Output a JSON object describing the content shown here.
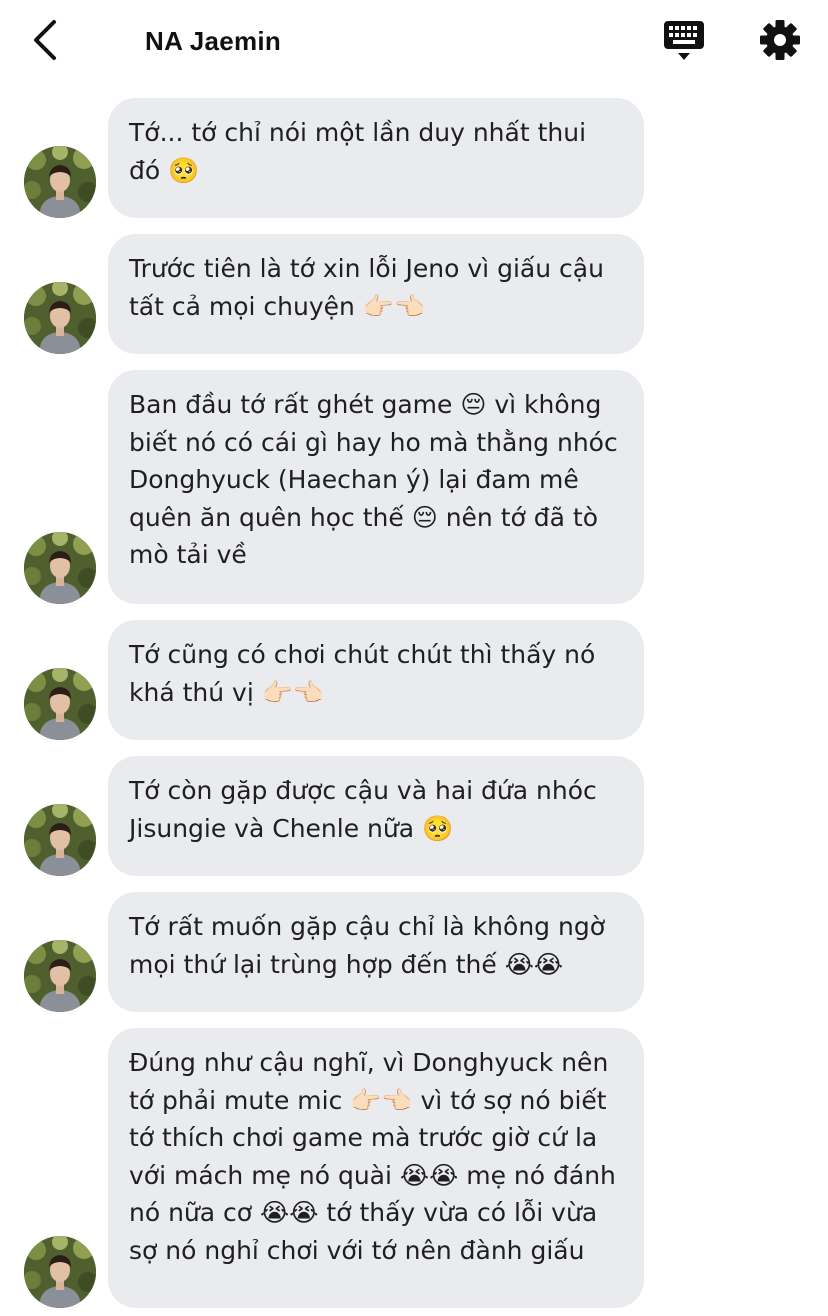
{
  "header": {
    "title": "NA Jaemin",
    "back_icon": "chevron-left-icon",
    "keyboard_icon": "keyboard-icon",
    "settings_icon": "gear-icon"
  },
  "colors": {
    "bubble": "#e9ebef",
    "text": "#1f1f22",
    "background": "#ffffff"
  },
  "messages": [
    {
      "text": "Tớ... tớ chỉ nói một lần duy nhất thui đó 🥺"
    },
    {
      "text": "Trước tiên là tớ xin lỗi Jeno vì giấu cậu tất cả mọi chuyện 👉🏻👈🏻"
    },
    {
      "text": "Ban đầu tớ rất ghét game 😔 vì không biết nó có cái gì hay ho mà thằng nhóc Donghyuck (Haechan ý) lại đam mê quên ăn quên học thế 😔 nên tớ đã tò mò tải về"
    },
    {
      "text": "Tớ cũng có chơi chút chút thì thấy nó khá thú vị 👉🏻👈🏻"
    },
    {
      "text": "Tớ còn gặp được cậu và hai đứa nhóc Jisungie và Chenle nữa 🥺"
    },
    {
      "text": "Tớ rất muốn gặp cậu chỉ là không ngờ mọi thứ lại trùng hợp đến thế 😭😭"
    },
    {
      "text": "Đúng như cậu nghĩ, vì Donghyuck nên tớ phải mute mic 👉🏻👈🏻 vì tớ sợ nó biết tớ thích chơi game mà trước giờ cứ la với mách mẹ nó quài 😭😭 mẹ nó đánh nó nữa cơ 😭😭 tớ thấy vừa có lỗi vừa sợ nó nghỉ chơi với tớ nên đành giấu"
    }
  ]
}
